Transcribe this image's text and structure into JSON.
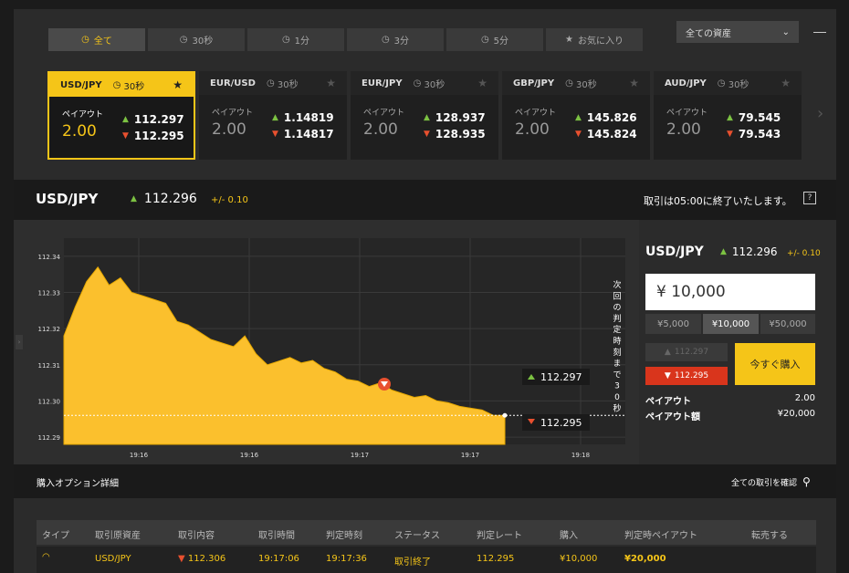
{
  "tabs": [
    {
      "icon": "clock-icon",
      "glyph": "◷",
      "label": "全て",
      "active": false
    },
    {
      "icon": "clock-icon",
      "glyph": "◷",
      "label": "30秒",
      "active": true
    },
    {
      "icon": "clock-icon",
      "glyph": "◷",
      "label": "1分",
      "active": false
    },
    {
      "icon": "clock-icon",
      "glyph": "◷",
      "label": "3分",
      "active": false
    },
    {
      "icon": "clock-icon",
      "glyph": "◷",
      "label": "5分",
      "active": false
    },
    {
      "icon": "star-icon",
      "glyph": "★",
      "label": "お気に入り",
      "active": false
    }
  ],
  "asset_select": {
    "value": "全ての資産",
    "arrow": "⌄"
  },
  "cards": [
    {
      "pair": "USD/JPY",
      "period": "30秒",
      "payout_label": "ペイアウト",
      "payout": "2.00",
      "high": "112.297",
      "low": "112.295",
      "active": true
    },
    {
      "pair": "EUR/USD",
      "period": "30秒",
      "payout_label": "ペイアウト",
      "payout": "2.00",
      "high": "1.14819",
      "low": "1.14817",
      "active": false
    },
    {
      "pair": "EUR/JPY",
      "period": "30秒",
      "payout_label": "ペイアウト",
      "payout": "2.00",
      "high": "128.937",
      "low": "128.935",
      "active": false
    },
    {
      "pair": "GBP/JPY",
      "period": "30秒",
      "payout_label": "ペイアウト",
      "payout": "2.00",
      "high": "145.826",
      "low": "145.824",
      "active": false
    },
    {
      "pair": "AUD/JPY",
      "period": "30秒",
      "payout_label": "ペイアウト",
      "payout": "2.00",
      "high": "79.545",
      "low": "79.543",
      "active": false
    }
  ],
  "pairbar": {
    "name": "USD/JPY",
    "rate": "112.296",
    "change": "+/- 0.10",
    "message": "取引は05:00に終了いたします。",
    "help": "?"
  },
  "chart_data": {
    "type": "area",
    "y_ticks": [
      "112.34",
      "112.33",
      "112.32",
      "112.31",
      "112.30",
      "112.29"
    ],
    "x_ticks": [
      "19:16",
      "19:16",
      "19:17",
      "19:17",
      "19:18"
    ],
    "series": [
      {
        "values": [
          112.318,
          112.326,
          112.333,
          112.337,
          112.332,
          112.334,
          112.33,
          112.329,
          112.328,
          112.327,
          112.322,
          112.321,
          112.319,
          112.317,
          112.316,
          112.315,
          112.318,
          112.313,
          112.31,
          112.311,
          112.312,
          112.3105,
          112.3112,
          112.309,
          112.308,
          112.306,
          112.3055,
          112.304,
          112.305,
          112.303,
          112.302,
          112.301,
          112.3015,
          112.3,
          112.2995,
          112.2985,
          112.298,
          112.2975,
          112.296,
          112.296
        ]
      }
    ],
    "y_range": [
      112.288,
      112.345
    ],
    "high_label": "112.297",
    "low_label": "112.295",
    "current_rate": 112.296,
    "countdown_text": "次回の判定時刻まで30秒"
  },
  "order_panel": {
    "name": "USD/JPY",
    "rate": "112.296",
    "change": "+/- 0.10",
    "amount": "¥ 10,000",
    "quick_amounts": [
      {
        "label": "¥5,000",
        "selected": false
      },
      {
        "label": "¥10,000",
        "selected": true
      },
      {
        "label": "¥50,000",
        "selected": false
      }
    ],
    "high_button": "112.297",
    "low_button": "112.295",
    "buy_label": "今すぐ購入",
    "payout_label": "ペイアウト",
    "payout_value": "2.00",
    "payout_amount_label": "ペイアウト額",
    "payout_amount_value": "¥20,000"
  },
  "history": {
    "title": "購入オプション詳細",
    "view_all": "全ての取引を確認",
    "columns": [
      "タイプ",
      "取引原資産",
      "取引内容",
      "取引時間",
      "判定時刻",
      "ステータス",
      "判定レート",
      "購入",
      "判定時ペイアウト",
      "転売する"
    ],
    "rows": [
      {
        "asset": "USD/JPY",
        "content": "112.306",
        "trade_time": "19:17:06",
        "judge_time": "19:17:36",
        "status": "取引終了",
        "rate": "112.295",
        "purchase": "¥10,000",
        "payout": "¥20,000",
        "resale": ""
      }
    ]
  },
  "colors": {
    "accent": "#f5c518",
    "up": "#7cc242",
    "down": "#e8502f"
  }
}
